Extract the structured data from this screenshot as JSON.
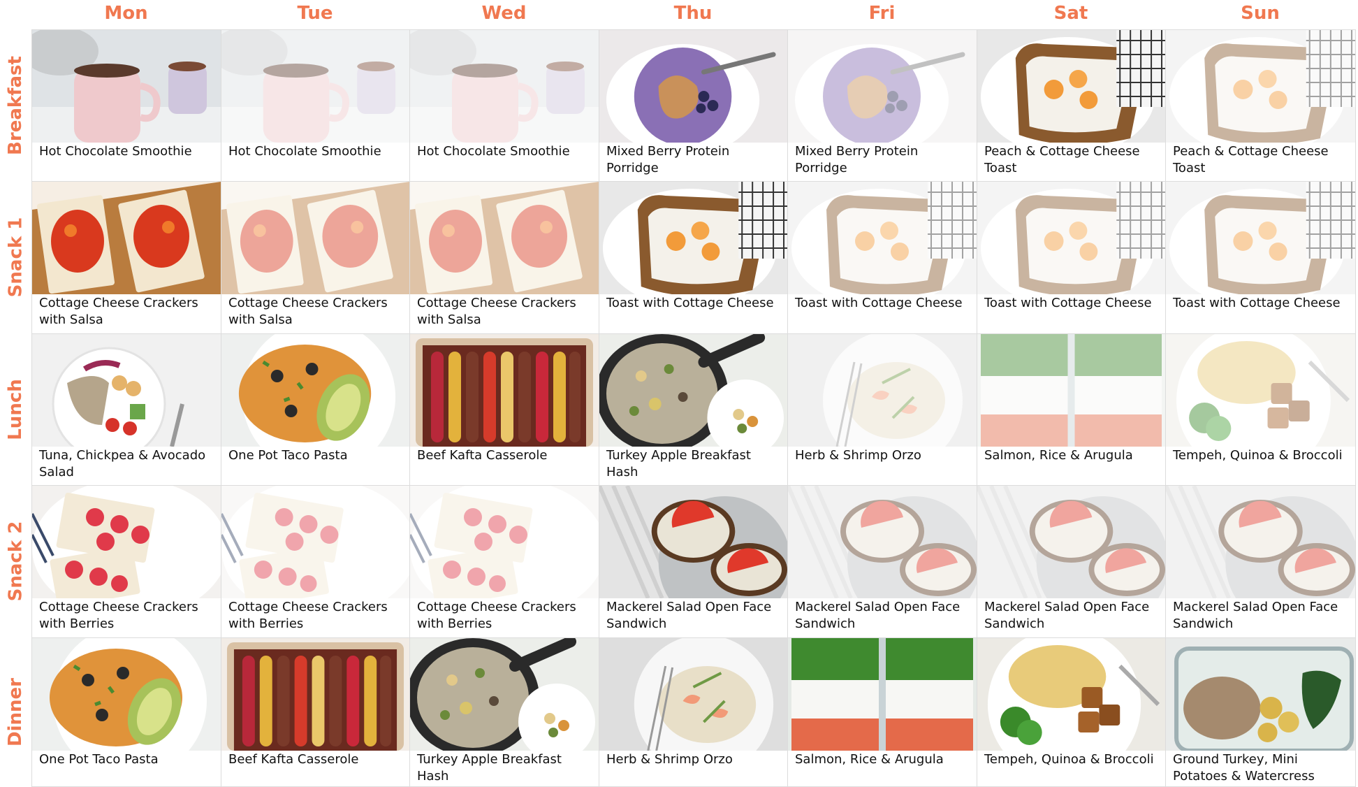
{
  "days": [
    "Mon",
    "Tue",
    "Wed",
    "Thu",
    "Fri",
    "Sat",
    "Sun"
  ],
  "meals": [
    {
      "label": "Breakfast",
      "cells": [
        {
          "title": "Hot Chocolate Smoothie",
          "icon": "mug-icon",
          "faded": false
        },
        {
          "title": "Hot Chocolate Smoothie",
          "icon": "mug-icon",
          "faded": true
        },
        {
          "title": "Hot Chocolate Smoothie",
          "icon": "mug-icon",
          "faded": true
        },
        {
          "title": "Mixed Berry Protein Porridge",
          "icon": "bowl-icon",
          "faded": false
        },
        {
          "title": "Mixed Berry Protein Porridge",
          "icon": "bowl-icon",
          "faded": true
        },
        {
          "title": "Peach & Cottage Cheese Toast",
          "icon": "toast-icon",
          "faded": false
        },
        {
          "title": "Peach & Cottage Cheese Toast",
          "icon": "toast-icon",
          "faded": true
        }
      ]
    },
    {
      "label": "Snack 1",
      "cells": [
        {
          "title": "Cottage Cheese Crackers with Salsa",
          "icon": "crackers-icon",
          "faded": false
        },
        {
          "title": "Cottage Cheese Crackers with Salsa",
          "icon": "crackers-icon",
          "faded": true
        },
        {
          "title": "Cottage Cheese Crackers with Salsa",
          "icon": "crackers-icon",
          "faded": true
        },
        {
          "title": "Toast with Cottage Cheese",
          "icon": "toast-icon",
          "faded": false
        },
        {
          "title": "Toast with Cottage Cheese",
          "icon": "toast-icon",
          "faded": true
        },
        {
          "title": "Toast with Cottage Cheese",
          "icon": "toast-icon",
          "faded": true
        },
        {
          "title": "Toast with Cottage Cheese",
          "icon": "toast-icon",
          "faded": true
        }
      ]
    },
    {
      "label": "Lunch",
      "cells": [
        {
          "title": "Tuna, Chickpea & Avocado Salad",
          "icon": "salad-bowl-icon",
          "faded": false
        },
        {
          "title": "One Pot Taco Pasta",
          "icon": "pasta-plate-icon",
          "faded": false
        },
        {
          "title": "Beef Kafta Casserole",
          "icon": "casserole-icon",
          "faded": false
        },
        {
          "title": "Turkey Apple Breakfast Hash",
          "icon": "skillet-icon",
          "faded": false
        },
        {
          "title": "Herb & Shrimp Orzo",
          "icon": "orzo-plate-icon",
          "faded": true
        },
        {
          "title": "Salmon, Rice & Arugula",
          "icon": "meal-prep-icon",
          "faded": true
        },
        {
          "title": "Tempeh, Quinoa & Broccoli",
          "icon": "quinoa-plate-icon",
          "faded": true
        }
      ]
    },
    {
      "label": "Snack 2",
      "cells": [
        {
          "title": "Cottage Cheese Crackers with Berries",
          "icon": "berry-crackers-icon",
          "faded": false
        },
        {
          "title": "Cottage Cheese Crackers with Berries",
          "icon": "berry-crackers-icon",
          "faded": true
        },
        {
          "title": "Cottage Cheese Crackers with Berries",
          "icon": "berry-crackers-icon",
          "faded": true
        },
        {
          "title": "Mackerel Salad Open Face Sandwich",
          "icon": "open-sandwich-icon",
          "faded": false
        },
        {
          "title": "Mackerel Salad Open Face Sandwich",
          "icon": "open-sandwich-icon",
          "faded": true
        },
        {
          "title": "Mackerel Salad Open Face Sandwich",
          "icon": "open-sandwich-icon",
          "faded": true
        },
        {
          "title": "Mackerel Salad Open Face Sandwich",
          "icon": "open-sandwich-icon",
          "faded": true
        }
      ]
    },
    {
      "label": "Dinner",
      "cells": [
        {
          "title": "One Pot Taco Pasta",
          "icon": "pasta-plate-icon",
          "faded": false
        },
        {
          "title": "Beef Kafta Casserole",
          "icon": "casserole-icon",
          "faded": false
        },
        {
          "title": "Turkey Apple Breakfast Hash",
          "icon": "skillet-icon",
          "faded": false
        },
        {
          "title": "Herb & Shrimp Orzo",
          "icon": "orzo-plate-icon",
          "faded": false
        },
        {
          "title": "Salmon, Rice & Arugula",
          "icon": "meal-prep-icon",
          "faded": false
        },
        {
          "title": "Tempeh, Quinoa & Broccoli",
          "icon": "quinoa-plate-icon",
          "faded": false
        },
        {
          "title": "Ground Turkey, Mini Potatoes & Watercress",
          "icon": "container-icon",
          "faded": false
        }
      ]
    }
  ],
  "colors": {
    "accent": "#f07850",
    "grid": "#dcdcdc",
    "text": "#111111"
  }
}
